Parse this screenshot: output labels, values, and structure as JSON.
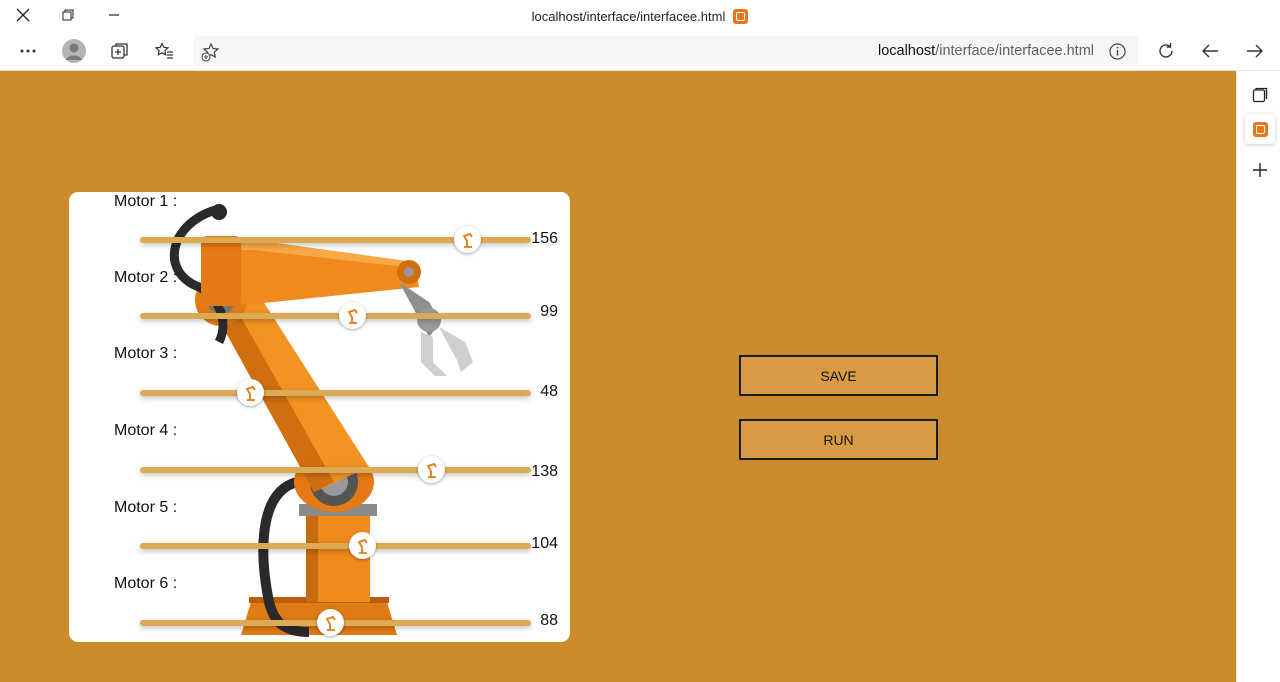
{
  "window": {
    "title": "localhost/interface/interfacee.html"
  },
  "toolbar": {
    "url_host": "localhost",
    "url_path": "/interface/interfacee.html"
  },
  "colors": {
    "page_background": "#cb8b2a",
    "button_fill": "#d99c44",
    "slider_track": "#dcaa55"
  },
  "motors": [
    {
      "label": "Motor 1 :",
      "value": "156"
    },
    {
      "label": "Motor 2 :",
      "value": "99"
    },
    {
      "label": "Motor 3 :",
      "value": "48"
    },
    {
      "label": "Motor 4 :",
      "value": "138"
    },
    {
      "label": "Motor 5 :",
      "value": "104"
    },
    {
      "label": "Motor 6 :",
      "value": "88"
    }
  ],
  "actions": {
    "save_label": "SAVE",
    "run_label": "RUN"
  },
  "icons": {
    "close": "close-icon",
    "restore": "restore-icon",
    "minimize": "minimize-icon",
    "menu": "more-options-icon",
    "profile": "profile-avatar-icon",
    "collections": "collections-icon",
    "favorites": "favorites-icon",
    "add_favorite": "add-favorite-icon",
    "info": "info-icon",
    "refresh": "refresh-icon",
    "back": "back-arrow-icon",
    "forward": "forward-arrow-icon",
    "slider_thumb": "robot-arm-icon"
  }
}
